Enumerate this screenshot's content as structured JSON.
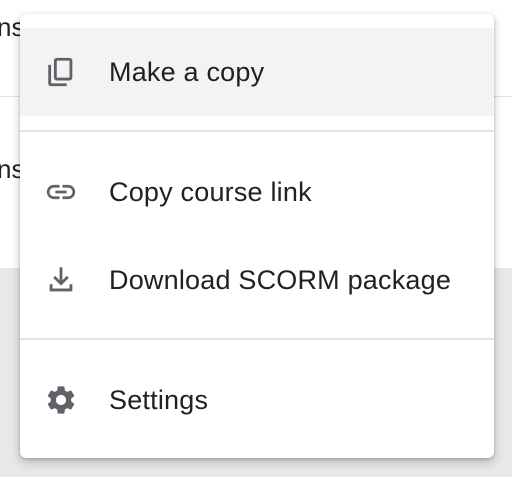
{
  "background": {
    "partial_text_1": "ns",
    "partial_text_2": "ns"
  },
  "menu": {
    "items": [
      {
        "label": "Make a copy",
        "icon": "copy-icon"
      },
      {
        "label": "Copy course link",
        "icon": "link-icon"
      },
      {
        "label": "Download SCORM package",
        "icon": "download-icon"
      },
      {
        "label": "Settings",
        "icon": "gear-icon"
      }
    ],
    "highlighted_item": "Make a copy"
  },
  "colors": {
    "icon": "#5f6368",
    "text": "#202124",
    "hover": "#f3f3f3",
    "divider": "#e3e3e3"
  }
}
